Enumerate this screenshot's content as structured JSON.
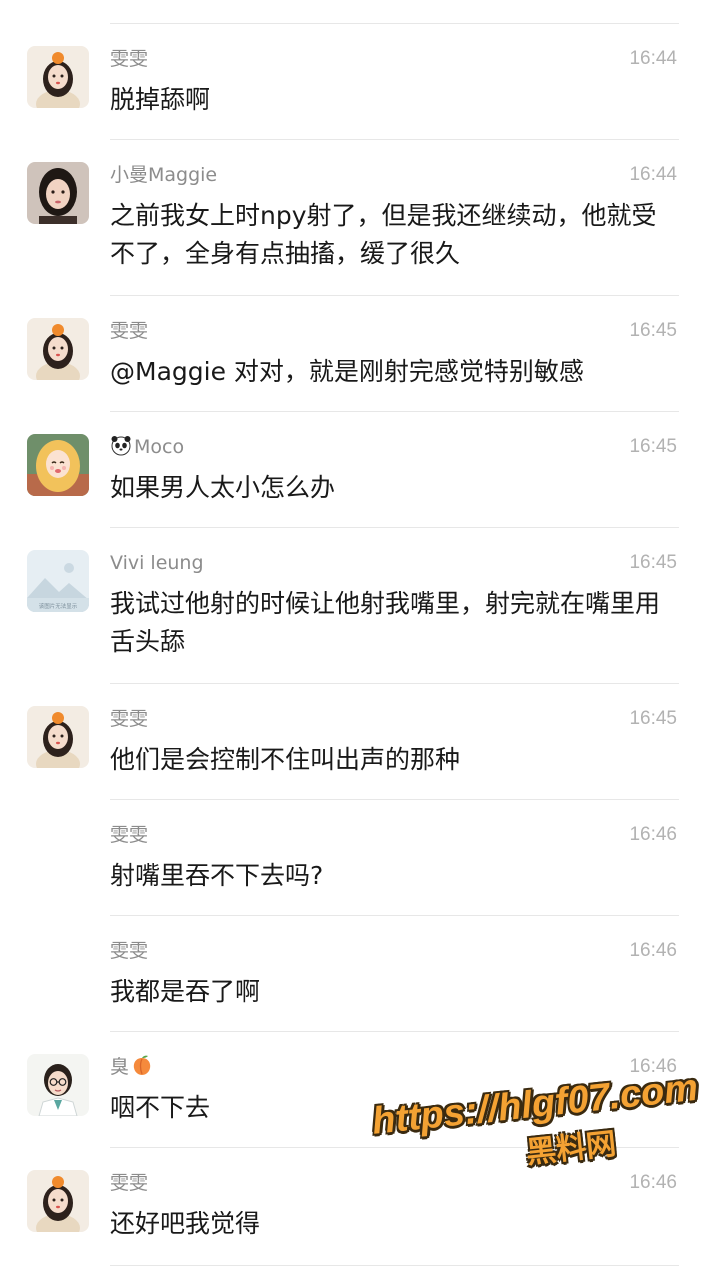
{
  "colors": {
    "sender": "#8c8c8c",
    "time": "#b2b2b2",
    "text": "#191919",
    "divider": "#e7e7e7",
    "watermark": "#f4a233"
  },
  "messages": [
    {
      "sender": "雯雯",
      "time": "16:44",
      "text": "脱掉舔啊",
      "avatar": "girl-orange-hat-avatar"
    },
    {
      "sender": "小曼Maggie",
      "time": "16:44",
      "text": "之前我女上时npy射了，但是我还继续动，他就受不了，全身有点抽搐，缓了很久",
      "avatar": "woman-selfie-avatar"
    },
    {
      "sender": "雯雯",
      "time": "16:45",
      "text": "@Maggie 对对，就是刚射完感觉特别敏感",
      "avatar": "girl-orange-hat-avatar"
    },
    {
      "sender_emoji": "panda-emoji",
      "sender": "Moco",
      "time": "16:45",
      "text": "如果男人太小怎么办",
      "avatar": "cartoon-blonde-girl-avatar"
    },
    {
      "sender": "Vivi leung",
      "time": "16:45",
      "text": "我试过他射的时候让他射我嘴里，射完就在嘴里用舌头舔",
      "avatar": "placeholder-image-avatar",
      "avatar_caption": "该图片无法显示"
    },
    {
      "sender": "雯雯",
      "time": "16:45",
      "text": "他们是会控制不住叫出声的那种",
      "avatar": "girl-orange-hat-avatar"
    },
    {
      "sender": "雯雯",
      "time": "16:46",
      "text": "射嘴里吞不下去吗?",
      "avatar": null
    },
    {
      "sender": "雯雯",
      "time": "16:46",
      "text": "我都是吞了啊",
      "avatar": null
    },
    {
      "sender": "臭",
      "sender_emoji_suffix": "peach-emoji",
      "time": "16:46",
      "text": "咽不下去",
      "avatar": "doctor-cartoon-avatar"
    },
    {
      "sender": "雯雯",
      "time": "16:46",
      "text": "还好吧我觉得",
      "avatar": "girl-orange-hat-avatar"
    }
  ],
  "watermark": {
    "url": "https://hlgf07.com",
    "site": "黑料网"
  }
}
